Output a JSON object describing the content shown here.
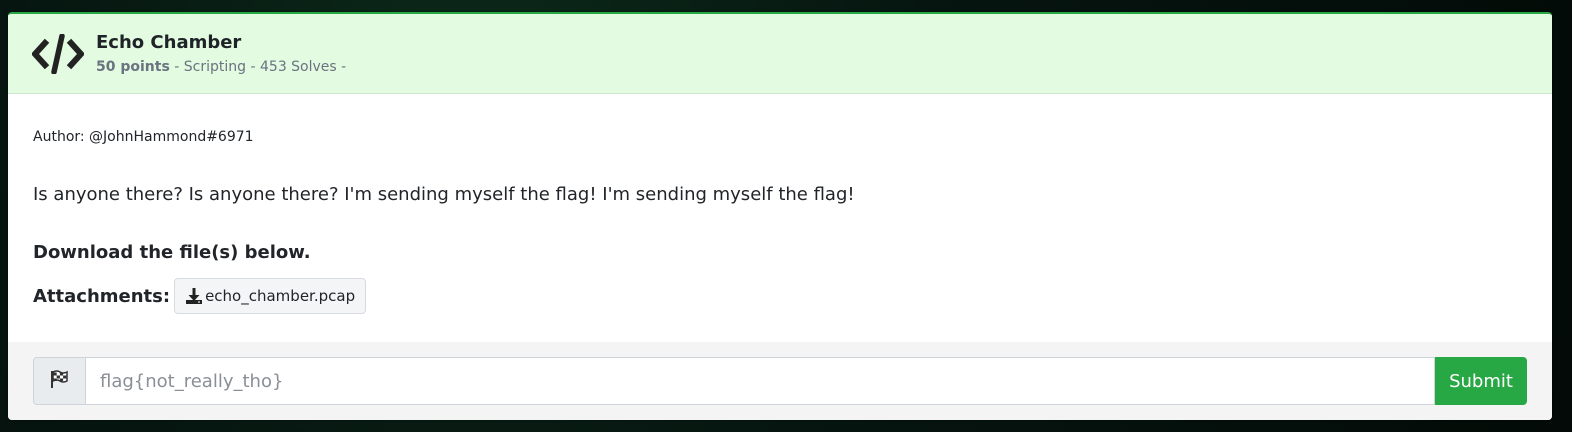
{
  "challenge": {
    "title": "Echo Chamber",
    "points": "50 points",
    "category": "Scripting",
    "solves": "453 Solves",
    "icon": "code-icon"
  },
  "body": {
    "author": "Author: @JohnHammond#6971",
    "description": "Is anyone there? Is anyone there? I'm sending myself the flag! I'm sending myself the flag!",
    "download_note": "Download the file(s) below.",
    "attachments_label": "Attachments:",
    "attachments": [
      {
        "name": "echo_chamber.pcap",
        "icon": "download-icon"
      }
    ]
  },
  "flag_form": {
    "icon": "checkered-flag-icon",
    "placeholder": "flag{not_really_tho}",
    "value": "",
    "submit_label": "Submit"
  },
  "colors": {
    "header_bg": "#e2fbe1",
    "accent": "#28a745",
    "text": "#212529",
    "muted": "#6b7280"
  }
}
